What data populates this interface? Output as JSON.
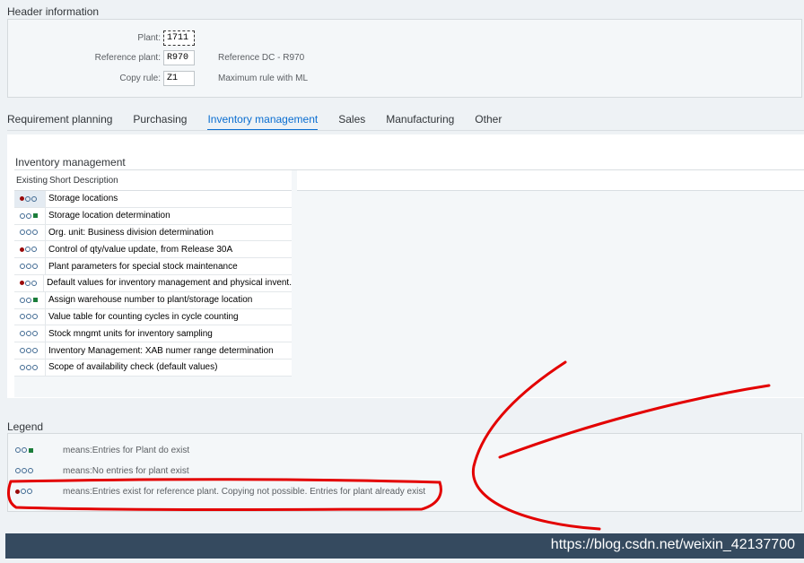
{
  "header": {
    "title": "Header information",
    "fields": [
      {
        "label": "Plant:",
        "value": "1711",
        "desc": ""
      },
      {
        "label": "Reference plant:",
        "value": "R970",
        "desc": "Reference DC - R970"
      },
      {
        "label": "Copy rule:",
        "value": "Z1",
        "desc": "Maximum rule with ML"
      }
    ]
  },
  "tabs": [
    "Requirement planning",
    "Purchasing",
    "Inventory management",
    "Sales",
    "Manufacturing",
    "Other"
  ],
  "active_tab": "Inventory management",
  "panel": {
    "title": "Inventory management",
    "col_existing": "Existing",
    "col_short_desc": "Short Description",
    "rows": [
      {
        "status": "red",
        "text": "Storage locations"
      },
      {
        "status": "green",
        "text": "Storage location determination"
      },
      {
        "status": "none",
        "text": "Org. unit: Business division determination"
      },
      {
        "status": "red",
        "text": "Control of qty/value update, from Release 30A"
      },
      {
        "status": "none",
        "text": "Plant parameters for special stock maintenance"
      },
      {
        "status": "red",
        "text": "Default values for inventory management and physical invent."
      },
      {
        "status": "green",
        "text": "Assign warehouse number to plant/storage location"
      },
      {
        "status": "none",
        "text": "Value table for counting cycles in cycle counting"
      },
      {
        "status": "none",
        "text": "Stock mngmt units for inventory sampling"
      },
      {
        "status": "none",
        "text": "Inventory Management: XAB numer range determination"
      },
      {
        "status": "none",
        "text": "Scope of availability check (default values)"
      }
    ]
  },
  "legend": {
    "title": "Legend",
    "items": [
      {
        "status": "green",
        "text": "means:Entries for Plant do exist"
      },
      {
        "status": "none",
        "text": "means:No entries for plant exist"
      },
      {
        "status": "red",
        "text": "means:Entries exist for reference plant. Copying not possible. Entries for plant already exist"
      }
    ]
  },
  "watermark": "https://blog.csdn.net/weixin_42137700",
  "colors": {
    "accent": "#0a6ed1",
    "status_bar": "#354a5f",
    "lamp_red": "#9b0b0b",
    "lamp_green": "#1b7d3a",
    "annotation": "#e30000"
  }
}
